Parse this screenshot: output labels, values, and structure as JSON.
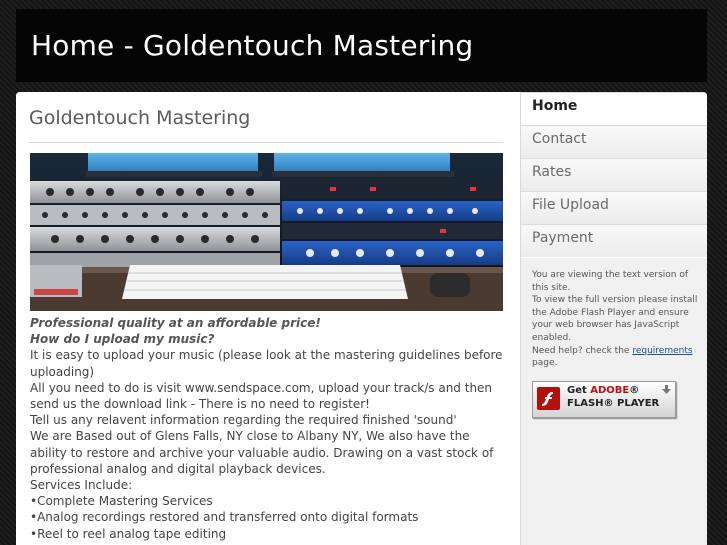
{
  "site": {
    "title": "Home - Goldentouch Mastering"
  },
  "main": {
    "heading": "Goldentouch Mastering",
    "tagline": "Professional quality at an affordable price!",
    "subheading": "How do I upload my music?",
    "paragraphs": [
      "It is easy to upload your music (please look at the mastering guidelines before uploading)",
      "All you need to do is visit www.sendspace.com, upload your track/s and then send us the download link - There is no need to register!",
      "Tell us any relavent information regarding the required finished 'sound'",
      "We are Based out of Glens Falls, NY close to Albany NY, We also have the ability to restore and archive your valuable audio. Drawing on a vast stock of professional analog and digital playback devices.",
      "Services Include:",
      "•Complete Mastering Services",
      "•Analog recordings restored and transferred onto digital formats",
      "•Reel to reel analog tape editing"
    ]
  },
  "nav": {
    "items": [
      {
        "label": "Home"
      },
      {
        "label": "Contact"
      },
      {
        "label": "Rates"
      },
      {
        "label": "File Upload"
      },
      {
        "label": "Payment"
      }
    ],
    "active": "Home"
  },
  "sidebar": {
    "notice_1": "You are viewing the text version of this site.",
    "notice_2": "To view the full version please install the Adobe Flash Player and ensure your web browser has JavaScript enabled.",
    "help_prefix": "Need help? check the ",
    "help_link": "requirements",
    "help_suffix": " page.",
    "flash_badge": {
      "get": "Get ",
      "adobe": "ADOBE",
      "reg": "®",
      "player": "FLASH® PLAYER"
    }
  },
  "colors": {
    "background": "#1b1b1b",
    "header": "#050505",
    "link": "#1a4fa0",
    "flash_red": "#b40f0f"
  }
}
